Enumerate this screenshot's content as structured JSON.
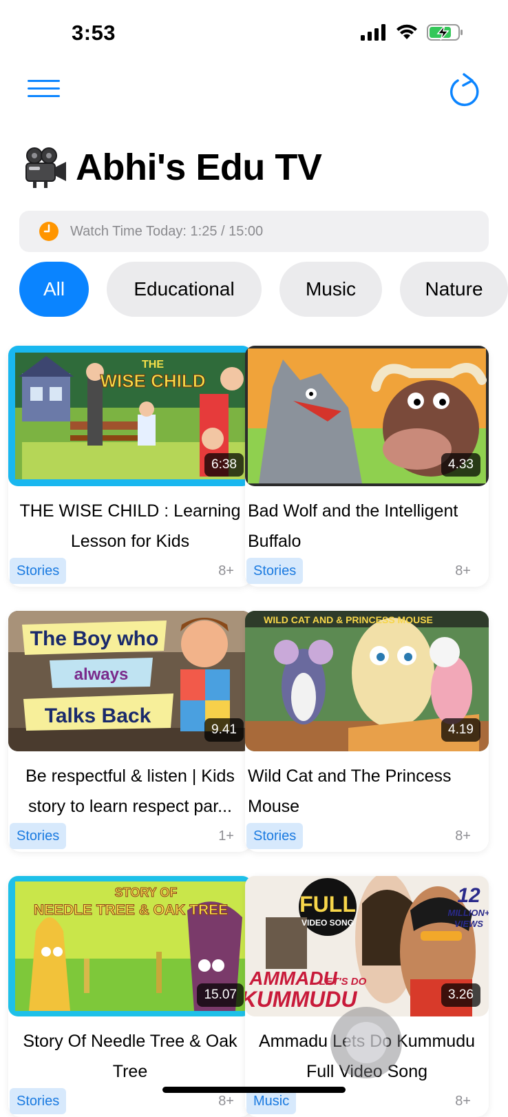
{
  "status_bar": {
    "time": "3:53"
  },
  "nav": {
    "menu_icon": "hamburger-menu-icon",
    "refresh_icon": "refresh-icon"
  },
  "header": {
    "title": "Abhi's Edu TV",
    "title_icon": "movie-camera-icon"
  },
  "watch_time": {
    "label": "Watch Time Today: 1:25 / 15:00",
    "icon": "clock-icon",
    "icon_color": "#ff9500"
  },
  "categories": [
    {
      "label": "All",
      "selected": true
    },
    {
      "label": "Educational",
      "selected": false
    },
    {
      "label": "Music",
      "selected": false
    },
    {
      "label": "Nature",
      "selected": false
    }
  ],
  "videos": [
    {
      "title": "THE WISE CHILD : Learning Lesson for Kids",
      "duration": "6:38",
      "tag": "Stories",
      "age": "8+",
      "thumbnail_text": [
        "THE",
        "WISE CHILD"
      ]
    },
    {
      "title": "Bad Wolf and the Intelligent Buffalo",
      "duration": "4.33",
      "tag": "Stories",
      "age": "8+",
      "thumbnail_text": []
    },
    {
      "title": "Be respectful & listen | Kids story to learn respect par...",
      "duration": "9.41",
      "tag": "Stories",
      "age": "1+",
      "thumbnail_text": [
        "The Boy who",
        "always",
        "Talks Back"
      ]
    },
    {
      "title": "Wild Cat and The Princess Mouse",
      "duration": "4.19",
      "tag": "Stories",
      "age": "8+",
      "thumbnail_text": [
        "WILD CAT AND & PRINCESS MOUSE"
      ]
    },
    {
      "title": "Story Of Needle Tree & Oak Tree",
      "duration": "15.07",
      "tag": "Stories",
      "age": "8+",
      "thumbnail_text": [
        "STORY OF",
        "NEEDLE TREE & OAK TREE"
      ]
    },
    {
      "title": "Ammadu Lets Do Kummudu Full Video Song",
      "duration": "3.26",
      "tag": "Music",
      "age": "8+",
      "thumbnail_text": [
        "FULL",
        "VIDEO SONG",
        "12",
        "MILLION+",
        "VIEWS",
        "AMMADU",
        "LET'S DO",
        "KUMMUDU"
      ]
    }
  ],
  "colors": {
    "accent": "#0a84ff",
    "chip_background": "#ebebed",
    "tag_background": "#d7e9fc",
    "tag_text": "#1a7ae0"
  }
}
